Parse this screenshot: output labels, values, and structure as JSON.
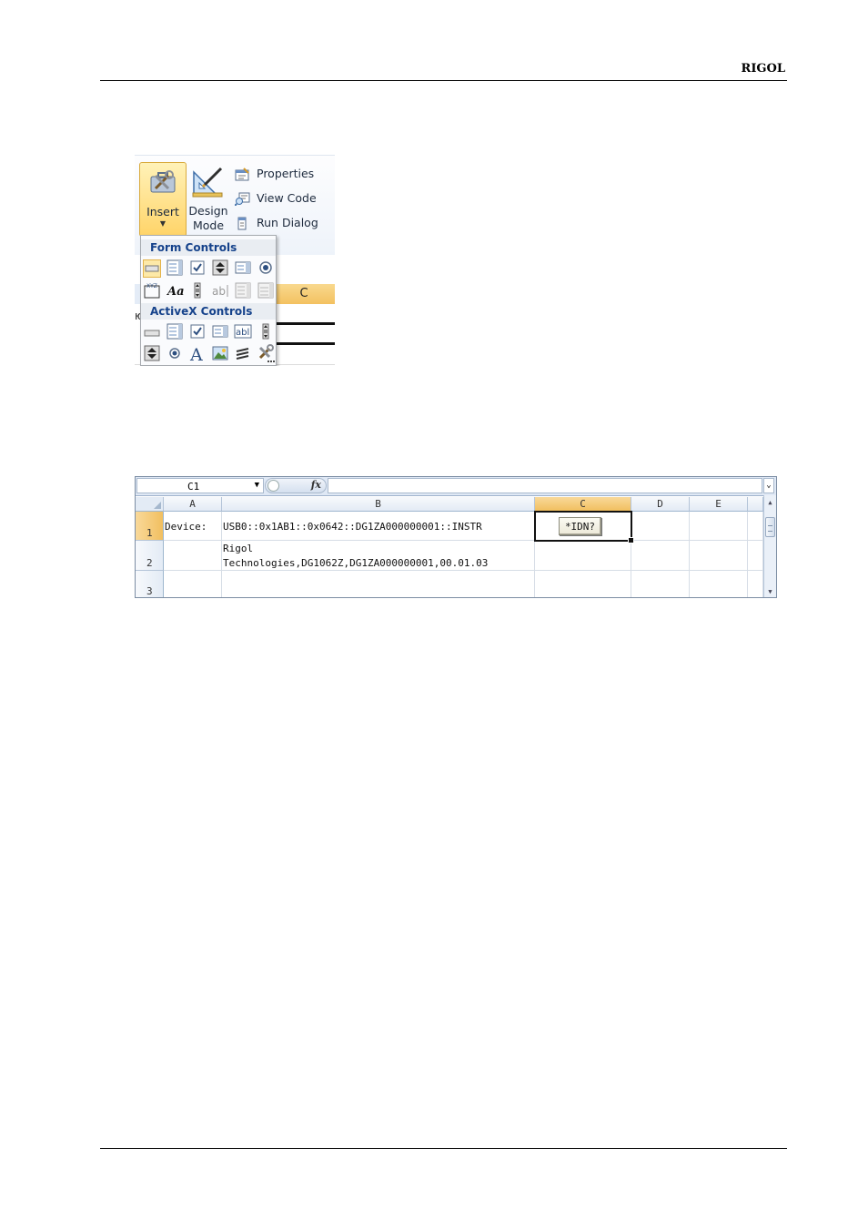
{
  "header": {
    "brand": "RIGOL"
  },
  "ribbon": {
    "insert_label": "Insert",
    "design_l1": "Design",
    "design_l2": "Mode",
    "properties": "Properties",
    "view_code": "View Code",
    "run_dialog": "Run Dialog"
  },
  "dropdown": {
    "form_controls": "Form Controls",
    "activex_controls": "ActiveX Controls"
  },
  "sheet_fragment": {
    "col_c": "C",
    "row_text": "ю"
  },
  "spreadsheet": {
    "name_box": "C1",
    "fx": "fx",
    "columns": [
      "A",
      "B",
      "C",
      "D",
      "E"
    ],
    "rows": [
      "1",
      "2",
      "3"
    ],
    "a1": "Device:",
    "b1": "USB0::0x1AB1::0x0642::DG1ZA000000001::INSTR",
    "b2_line1": "Rigol",
    "b2_line2": "Technologies,DG1062Z,DG1ZA000000001,00.01.03",
    "button": "*IDN?"
  }
}
